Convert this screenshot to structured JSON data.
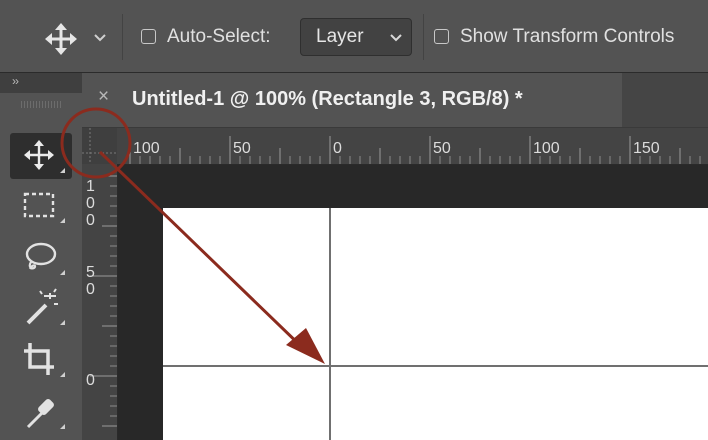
{
  "options_bar": {
    "move_tool_icon": "move-arrows-icon",
    "auto_select_label": "Auto-Select:",
    "auto_select_checked": false,
    "auto_select_target": "Layer",
    "show_transform_label": "Show Transform Controls",
    "show_transform_checked": false
  },
  "toolbox": {
    "collapse_label": "››",
    "tools": [
      {
        "icon": "move-tool-icon",
        "active": true
      },
      {
        "icon": "rectangular-marquee-icon",
        "active": false
      },
      {
        "icon": "lasso-icon",
        "active": false
      },
      {
        "icon": "magic-wand-icon",
        "active": false
      },
      {
        "icon": "crop-icon",
        "active": false
      },
      {
        "icon": "eyedropper-icon",
        "active": false
      }
    ]
  },
  "document": {
    "close_label": "×",
    "tab_title": "Untitled-1 @ 100% (Rectangle 3, RGB/8) *"
  },
  "rulers": {
    "horizontal_labels": [
      "100",
      "50",
      "0",
      "50",
      "100",
      "150"
    ],
    "vertical_labels": [
      "100",
      "50",
      "0"
    ]
  },
  "annotation": {
    "color": "#8b2b1e"
  }
}
